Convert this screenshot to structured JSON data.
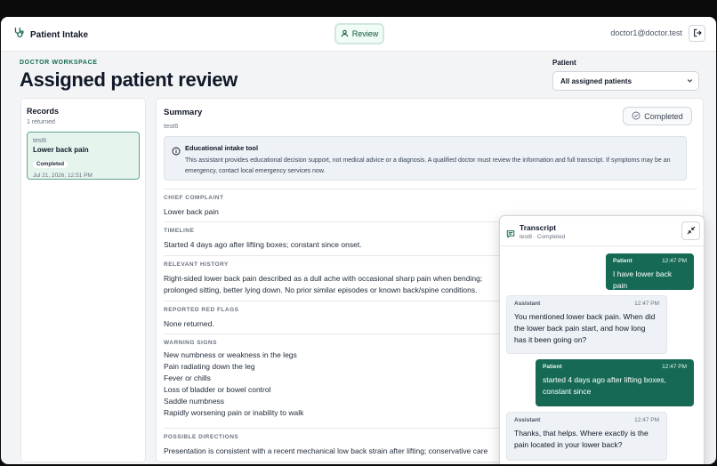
{
  "header": {
    "app_name": "Patient Intake",
    "nav_review": "Review",
    "user_email": "doctor1@doctor.test"
  },
  "page": {
    "eyebrow": "DOCTOR WORKSPACE",
    "title": "Assigned patient review",
    "patient_label": "Patient",
    "patient_selected": "All assigned patients"
  },
  "records": {
    "title": "Records",
    "count": "1 returned",
    "items": [
      {
        "patient": "test6",
        "title": "Lower back pain",
        "status": "Completed",
        "date": "Jul 21, 2026, 12:51 PM"
      }
    ]
  },
  "summary": {
    "title": "Summary",
    "patient": "test6",
    "status": "Completed",
    "notice_title": "Educational intake tool",
    "notice_body": "This assistant provides educational decision support, not medical advice or a diagnosis. A qualified doctor must review the information and full transcript. If symptoms may be an emergency, contact local emergency services now.",
    "sections": {
      "chief_complaint_label": "CHIEF COMPLAINT",
      "chief_complaint": "Lower back pain",
      "timeline_label": "TIMELINE",
      "timeline": "Started 4 days ago after lifting boxes; constant since onset.",
      "history_label": "RELEVANT HISTORY",
      "history": "Right-sided lower back pain described as a dull ache with occasional sharp pain when bending; prolonged sitting, better lying down. No prior similar episodes or known back/spine conditions.",
      "red_flags_label": "REPORTED RED FLAGS",
      "red_flags": "None returned.",
      "warning_label": "WARNING SIGNS",
      "warning_items": [
        "New numbness or weakness in the legs",
        "Pain radiating down the leg",
        "Fever or chills",
        "Loss of bladder or bowel control",
        "Saddle numbness",
        "Rapidly worsening pain or inability to walk"
      ],
      "directions_label": "POSSIBLE DIRECTIONS",
      "directions": "Presentation is consistent with a recent mechanical low back strain after lifting; conservative care"
    }
  },
  "transcript": {
    "title": "Transcript",
    "subtitle": "test6 · Completed",
    "messages": [
      {
        "role": "Patient",
        "time": "12:47 PM",
        "text": "I have lower back pain"
      },
      {
        "role": "Assistant",
        "time": "12:47 PM",
        "text": "You mentioned lower back pain. When did the lower back pain start, and how long has it been going on?"
      },
      {
        "role": "Patient",
        "time": "12:47 PM",
        "text": "started 4 days ago after lifting boxes, constant since"
      },
      {
        "role": "Assistant",
        "time": "12:47 PM",
        "text": "Thanks, that helps. Where exactly is the pain located in your lower back?"
      }
    ]
  },
  "colors": {
    "accent": "#166a55",
    "selected_record_bg": "#e6f4ee"
  },
  "icons": {
    "brand": "stethoscope-icon",
    "review": "user-icon",
    "logout": "logout-icon",
    "completed": "check-circle-icon",
    "notice": "info-icon",
    "transcript": "chat-icon",
    "collapse": "collapse-icon",
    "select": "chevron-down-icon"
  }
}
